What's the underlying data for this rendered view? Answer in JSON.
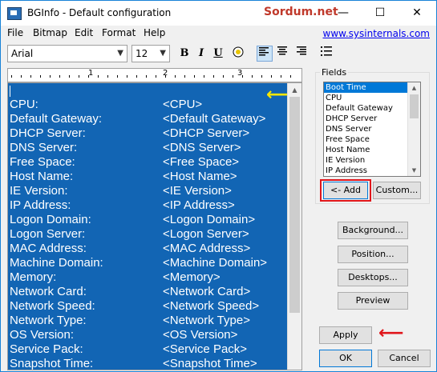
{
  "window": {
    "title": "BGInfo - Default configuration",
    "watermark": "Sordum.net",
    "minimize": "—",
    "maximize": "☐",
    "close": "✕"
  },
  "menu": {
    "items": [
      "File",
      "Bitmap",
      "Edit",
      "Format",
      "Help"
    ],
    "link": "www.sysinternals.com"
  },
  "toolbar": {
    "font": "Arial",
    "size": "12",
    "bold": "B",
    "italic": "I",
    "underline": "U"
  },
  "ruler": {
    "marks": [
      "1",
      "2",
      "3"
    ]
  },
  "editor": {
    "rows": [
      {
        "label": "CPU:",
        "value": "<CPU>"
      },
      {
        "label": "Default Gateway:",
        "value": "<Default Gateway>"
      },
      {
        "label": "DHCP Server:",
        "value": "<DHCP Server>"
      },
      {
        "label": "DNS Server:",
        "value": "<DNS Server>"
      },
      {
        "label": "Free Space:",
        "value": "<Free Space>"
      },
      {
        "label": "Host Name:",
        "value": "<Host Name>"
      },
      {
        "label": "IE Version:",
        "value": "<IE Version>"
      },
      {
        "label": "IP Address:",
        "value": "<IP Address>"
      },
      {
        "label": "Logon Domain:",
        "value": "<Logon Domain>"
      },
      {
        "label": "Logon Server:",
        "value": "<Logon Server>"
      },
      {
        "label": "MAC Address:",
        "value": "<MAC Address>"
      },
      {
        "label": "Machine Domain:",
        "value": "<Machine Domain>"
      },
      {
        "label": "Memory:",
        "value": "<Memory>"
      },
      {
        "label": "Network Card:",
        "value": "<Network Card>"
      },
      {
        "label": "Network Speed:",
        "value": "<Network Speed>"
      },
      {
        "label": "Network Type:",
        "value": "<Network Type>"
      },
      {
        "label": "OS Version:",
        "value": "<OS Version>"
      },
      {
        "label": "Service Pack:",
        "value": "<Service Pack>"
      },
      {
        "label": "Snapshot Time:",
        "value": "<Snapshot Time>"
      }
    ]
  },
  "fields": {
    "label": "Fields",
    "items": [
      "Boot Time",
      "CPU",
      "Default Gateway",
      "DHCP Server",
      "DNS Server",
      "Free Space",
      "Host Name",
      "IE Version",
      "IP Address"
    ],
    "selected": "Boot Time"
  },
  "buttons": {
    "add": "<- Add",
    "custom": "Custom...",
    "background": "Background...",
    "position": "Position...",
    "desktops": "Desktops...",
    "preview": "Preview",
    "apply": "Apply",
    "ok": "OK",
    "cancel": "Cancel"
  },
  "colors": {
    "editor_bg": "#1265b4",
    "highlight_box": "#e0161b",
    "yellow_arrow": "#f7e600",
    "selection": "#0078d7"
  },
  "icons": [
    "app-icon",
    "align-left-icon",
    "align-center-icon",
    "align-right-icon",
    "bullets-icon",
    "fill-icon",
    "yellow-arrow-icon",
    "red-arrow-icon"
  ]
}
